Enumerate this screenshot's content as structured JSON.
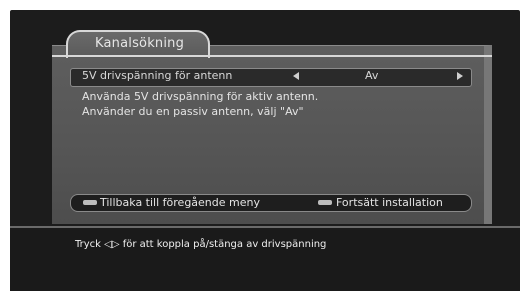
{
  "title": "Kanalsökning",
  "option": {
    "label": "5V drivspänning för antenn",
    "value": "Av"
  },
  "description": {
    "line1": "Använda 5V drivspänning för aktiv antenn.",
    "line2": "Använder du en passiv antenn, välj \"Av\""
  },
  "buttons": {
    "back": "Tillbaka till föregående meny",
    "continue": "Fortsätt installation"
  },
  "hint": "Tryck ◁▷ för att koppla på/stänga av drivspänning",
  "colors": {
    "panel": "#555555",
    "background": "#1c1c1c",
    "text": "#e4e4e4"
  },
  "icons": {
    "left_arrow": "left-arrow-icon",
    "right_arrow": "right-arrow-icon",
    "button_swatch": "button-key-icon"
  }
}
